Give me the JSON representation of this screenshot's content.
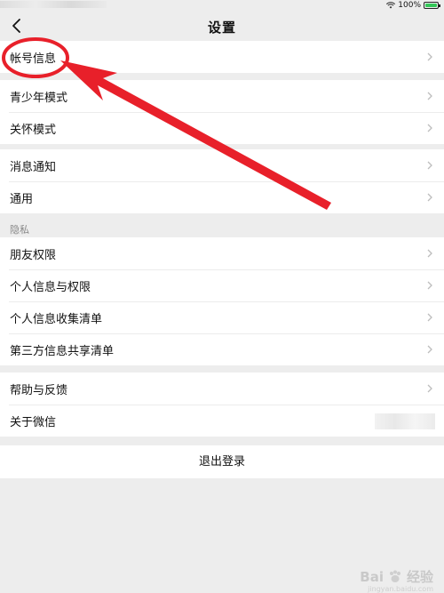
{
  "statusbar": {
    "battery_text": "100%",
    "icons": [
      "wifi-icon",
      "battery-icon"
    ]
  },
  "header": {
    "title": "设置",
    "back_icon": "chevron-left-icon"
  },
  "groups": [
    {
      "items": [
        {
          "label": "帐号信息"
        }
      ]
    },
    {
      "items": [
        {
          "label": "青少年模式"
        },
        {
          "label": "关怀模式"
        }
      ]
    },
    {
      "items": [
        {
          "label": "消息通知"
        },
        {
          "label": "通用"
        }
      ]
    },
    {
      "section_label": "隐私",
      "items": [
        {
          "label": "朋友权限"
        },
        {
          "label": "个人信息与权限"
        },
        {
          "label": "个人信息收集清单"
        },
        {
          "label": "第三方信息共享清单"
        }
      ]
    },
    {
      "items": [
        {
          "label": "帮助与反馈"
        },
        {
          "label": "关于微信"
        }
      ]
    }
  ],
  "logout_label": "退出登录",
  "annotation": {
    "color": "#e8202a",
    "shape": "ellipse-with-arrow"
  },
  "watermark": {
    "brand": "Bai",
    "brand2": "经验",
    "domain": "jingyan.baidu.com"
  }
}
